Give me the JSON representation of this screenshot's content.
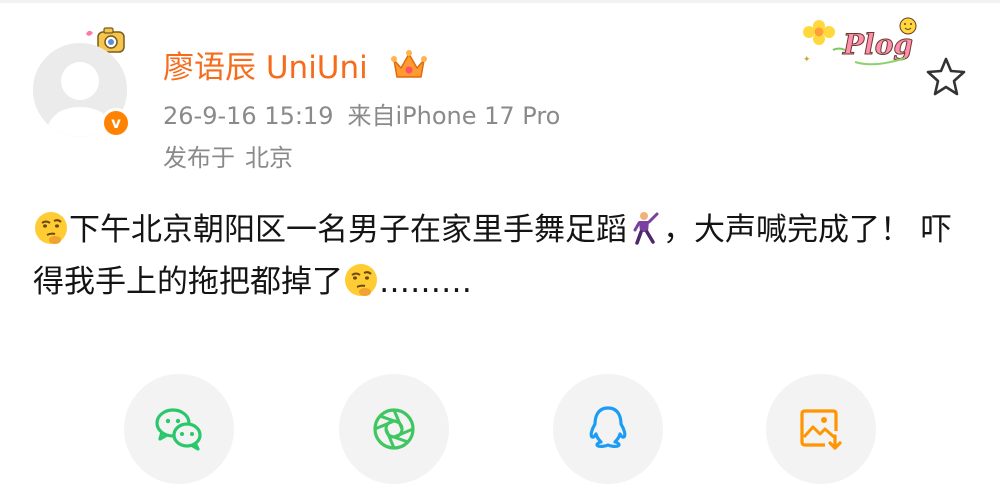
{
  "user": {
    "name": "廖语辰 UniUni",
    "verified_badge": "v",
    "avatar_icon": "default-avatar-icon",
    "crown_icon": "crown-icon"
  },
  "post": {
    "datetime": "26-9-16 15:19",
    "source": "来自iPhone 17 Pro",
    "location_prefix": "发布于",
    "location": "北京",
    "text_part1": "下午北京朝阳区一名男子在家里手舞足蹈",
    "text_part2": "，大声喊完成了！ 吓得我手上的拖把都掉了",
    "text_part3": "………",
    "emojis": [
      "thinking-face-emoji",
      "dancing-man-emoji",
      "thinking-face-emoji"
    ]
  },
  "badges": {
    "plog_text": "Plog",
    "star_icon": "star-icon"
  },
  "share": [
    {
      "name": "wechat",
      "icon": "wechat-icon",
      "color": "#2ac76b"
    },
    {
      "name": "moments",
      "icon": "moments-icon",
      "color": "#3fc660"
    },
    {
      "name": "qq",
      "icon": "qq-icon",
      "color": "#1d9cf5"
    },
    {
      "name": "save-image",
      "icon": "save-image-icon",
      "color": "#ff9500"
    }
  ],
  "colors": {
    "username": "#f56c1c",
    "meta_text": "#8a8a8a",
    "body_text": "#141414",
    "verified": "#ff8200"
  }
}
